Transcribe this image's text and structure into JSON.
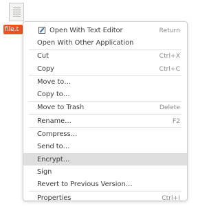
{
  "desktop": {
    "file_label": "file.t"
  },
  "menu": {
    "groups": [
      [
        {
          "label": "Open With Text Editor",
          "shortcut": "Return",
          "icon": "text-editor-icon"
        },
        {
          "label": "Open With Other Application",
          "shortcut": ""
        }
      ],
      [
        {
          "label": "Cut",
          "shortcut": "Ctrl+X"
        },
        {
          "label": "Copy",
          "shortcut": "Ctrl+C"
        }
      ],
      [
        {
          "label": "Move to…",
          "shortcut": ""
        },
        {
          "label": "Copy to…",
          "shortcut": ""
        }
      ],
      [
        {
          "label": "Move to Trash",
          "shortcut": "Delete"
        }
      ],
      [
        {
          "label": "Rename…",
          "shortcut": "F2"
        }
      ],
      [
        {
          "label": "Compress…",
          "shortcut": ""
        },
        {
          "label": "Send to…",
          "shortcut": ""
        },
        {
          "label": "Encrypt…",
          "shortcut": "",
          "highlighted": true
        },
        {
          "label": "Sign",
          "shortcut": ""
        },
        {
          "label": "Revert to Previous Version…",
          "shortcut": ""
        }
      ],
      [
        {
          "label": "Properties",
          "shortcut": "Ctrl+I"
        }
      ]
    ]
  },
  "colors": {
    "selection_accent": "#e95420",
    "highlight": "#dedede"
  }
}
